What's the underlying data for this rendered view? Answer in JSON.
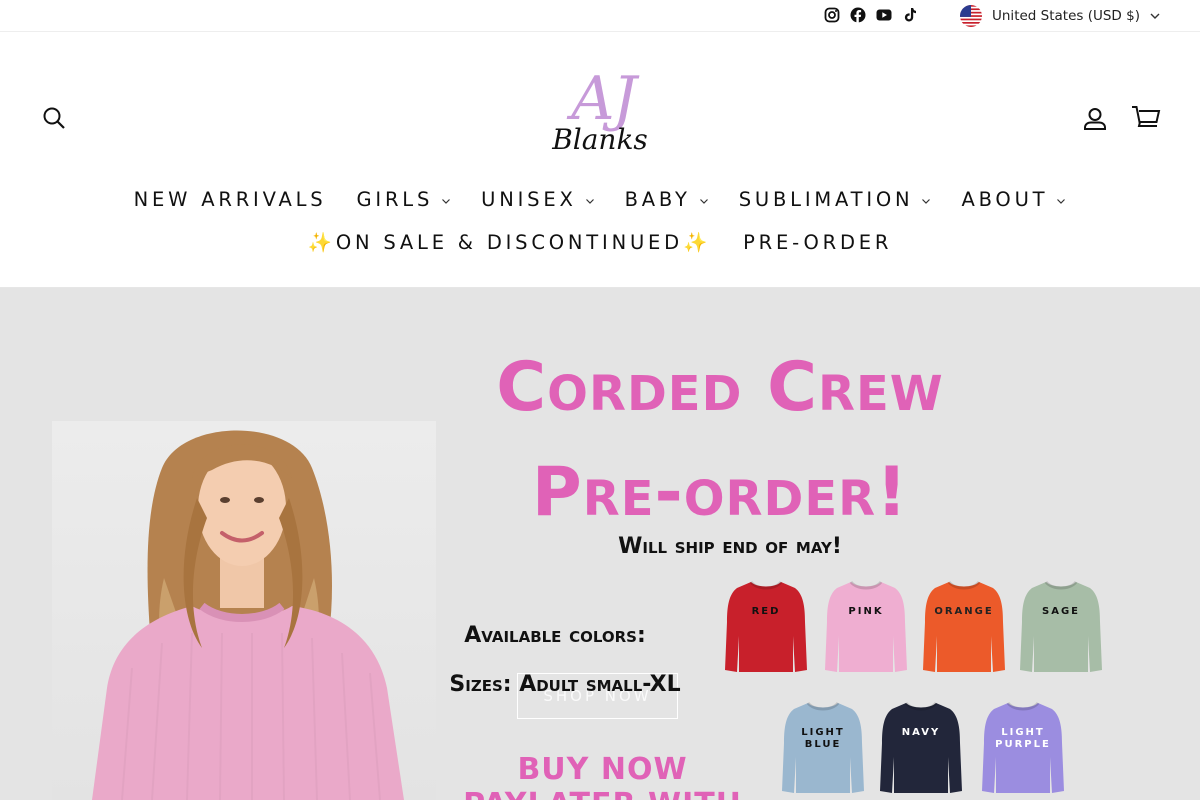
{
  "topbar": {
    "socials": [
      {
        "icon": "instagram-icon"
      },
      {
        "icon": "facebook-icon"
      },
      {
        "icon": "youtube-icon"
      },
      {
        "icon": "tiktok-icon"
      }
    ],
    "currency": {
      "label": "United States (USD $)",
      "flag": "us-flag-icon"
    }
  },
  "header": {
    "logo": {
      "line1": "AJ",
      "line2": "Blanks"
    },
    "nav_row1": [
      {
        "label": "NEW ARRIVALS",
        "dropdown": false
      },
      {
        "label": "GIRLS",
        "dropdown": true
      },
      {
        "label": "UNISEX",
        "dropdown": true
      },
      {
        "label": "BABY",
        "dropdown": true
      },
      {
        "label": "SUBLIMATION",
        "dropdown": true
      },
      {
        "label": "ABOUT",
        "dropdown": true
      }
    ],
    "nav_row2": [
      {
        "label": "✨ON SALE & DISCONTINUED✨"
      },
      {
        "label": "PRE-ORDER"
      }
    ]
  },
  "hero": {
    "headline_1": "Corded Crew",
    "headline_2": "Pre-order!",
    "ship_note": "Will ship end of may!",
    "available_colors": "Available colors:",
    "sizes": "Sizes: Adult small-XL",
    "shop_button": "SHOP NOW",
    "buy_now": "BUY NOW PAYLATER WITH",
    "colors": {
      "accent_pink": "#e062b7",
      "background": "#e4e4e4"
    },
    "swatches": [
      {
        "label": "RED",
        "color": "#c8202b",
        "text_color": "#111111"
      },
      {
        "label": "PINK",
        "color": "#efaed1",
        "text_color": "#111111"
      },
      {
        "label": "ORANGE",
        "color": "#ec5a2a",
        "text_color": "#222222"
      },
      {
        "label": "SAGE",
        "color": "#a7bda7",
        "text_color": "#111111"
      },
      {
        "label": "LIGHT BLUE",
        "color": "#9ab7cf",
        "text_color": "#111111"
      },
      {
        "label": "NAVY",
        "color": "#22263a",
        "text_color": "#ffffff"
      },
      {
        "label": "LIGHT PURPLE",
        "color": "#9b8de0",
        "text_color": "#ffffff"
      }
    ]
  }
}
